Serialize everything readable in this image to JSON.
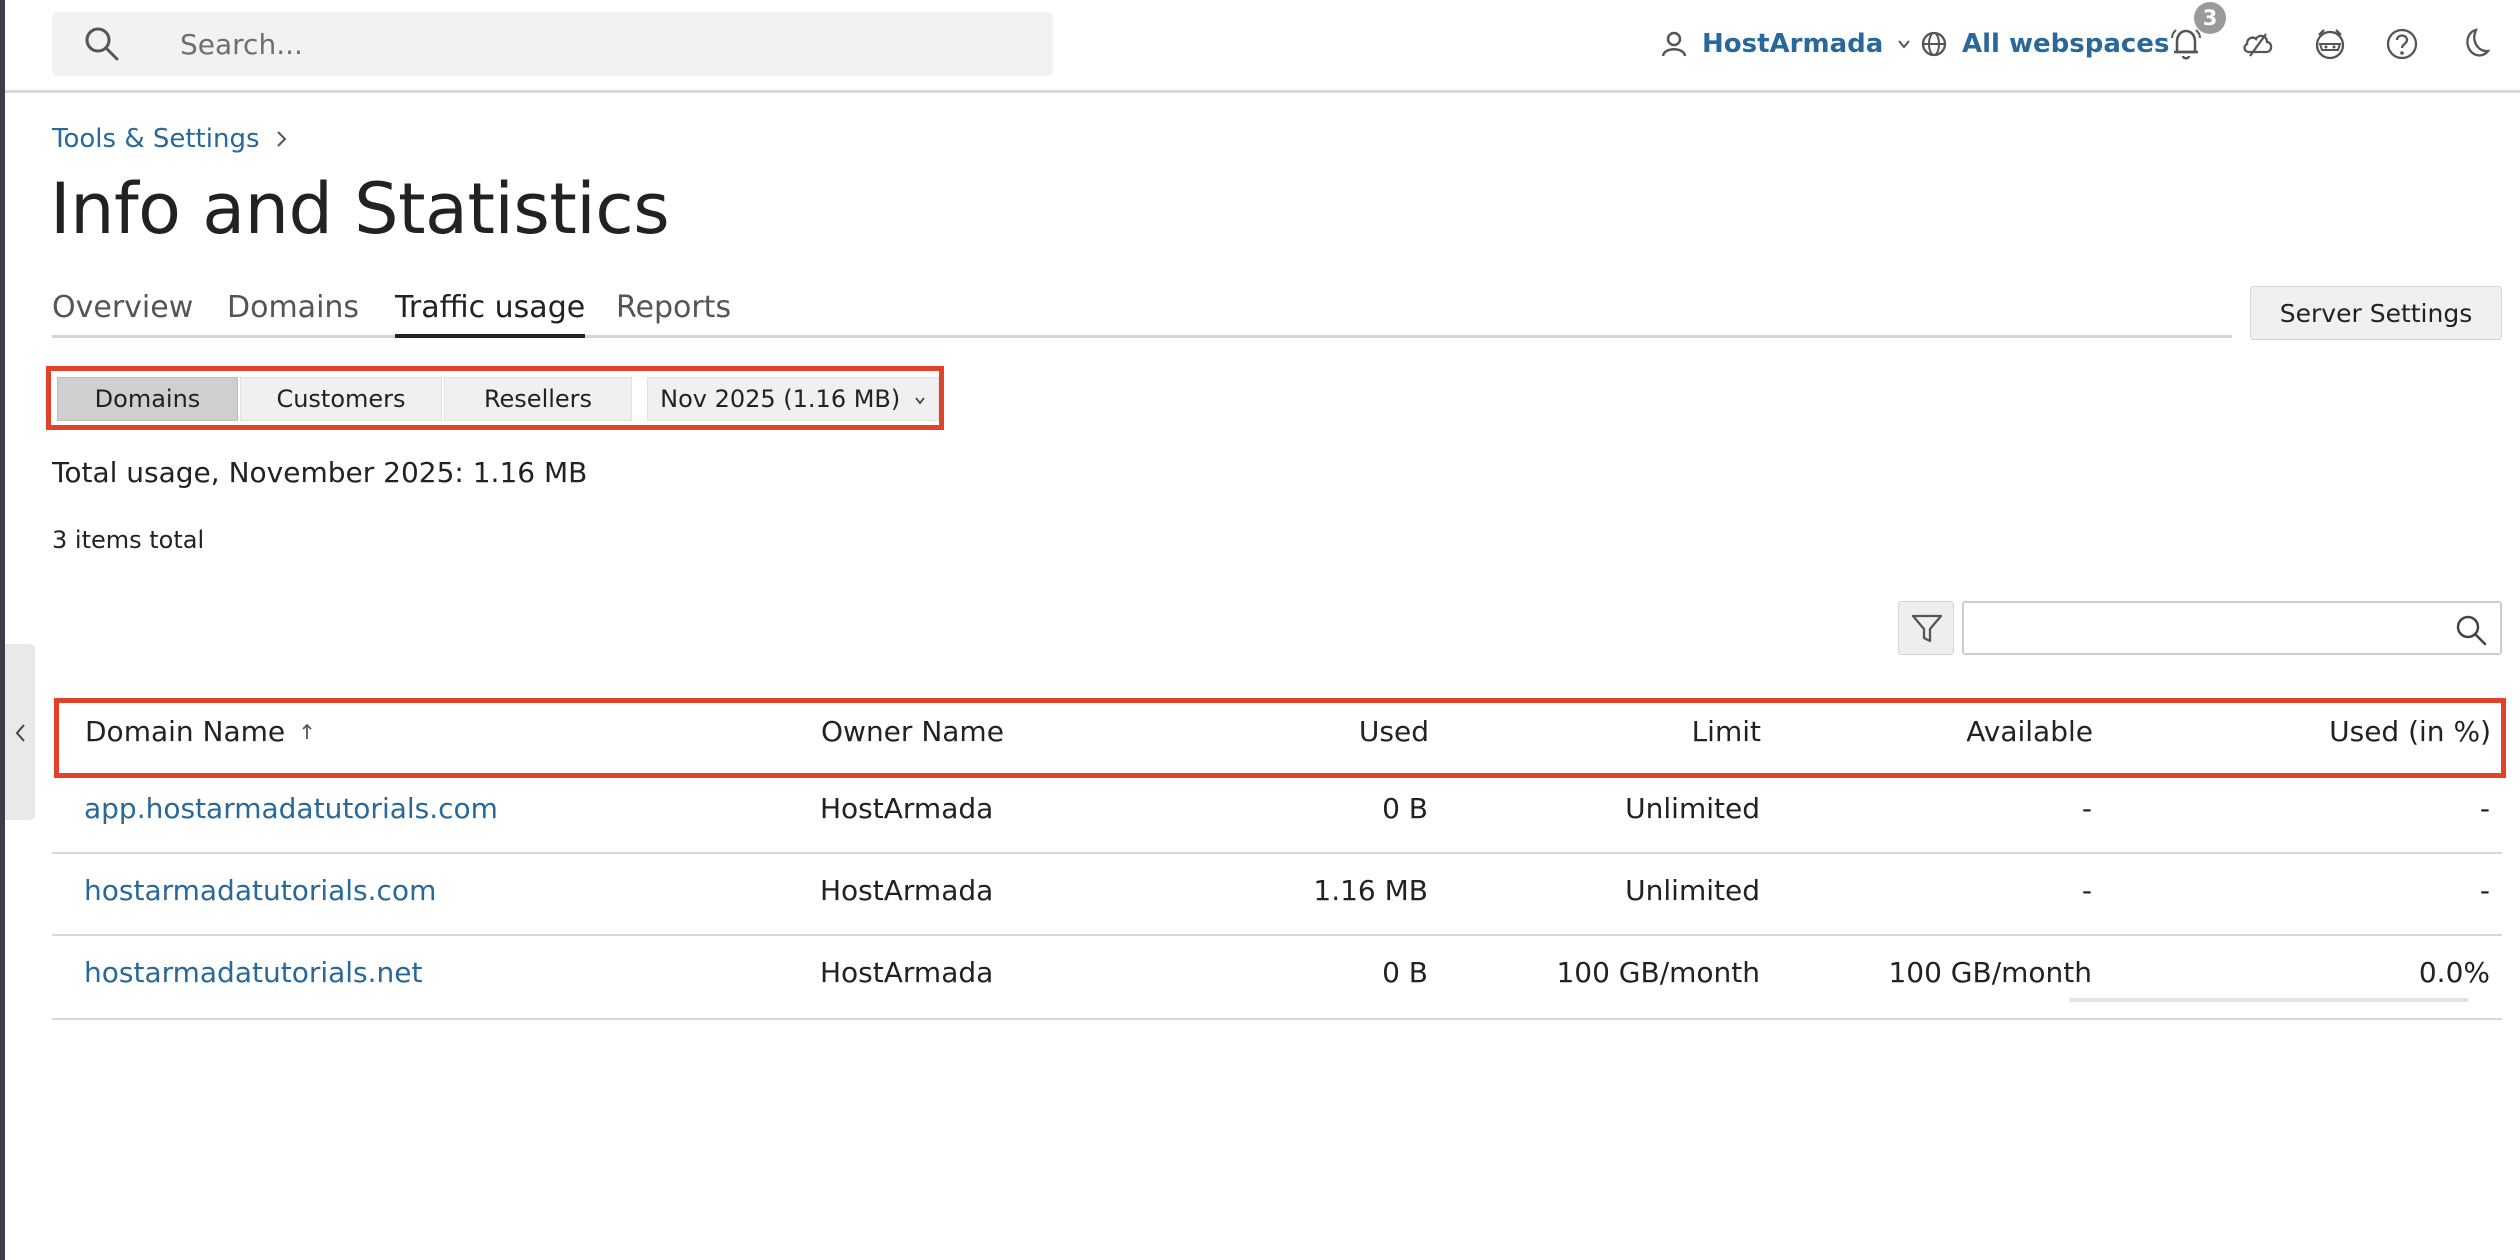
{
  "header": {
    "search_placeholder": "Search...",
    "user_label": "HostArmada",
    "webspaces_label": "All webspaces",
    "notification_count": "3"
  },
  "breadcrumb": {
    "item": "Tools & Settings"
  },
  "page": {
    "title": "Info and Statistics"
  },
  "tabs": [
    {
      "label": "Overview",
      "active": false
    },
    {
      "label": "Domains",
      "active": false
    },
    {
      "label": "Traffic usage",
      "active": true
    },
    {
      "label": "Reports",
      "active": false
    }
  ],
  "server_settings_label": "Server Settings",
  "segments": {
    "domains": "Domains",
    "customers": "Customers",
    "resellers": "Resellers",
    "period": "Nov 2025 (1.16 MB)"
  },
  "summary": {
    "total_usage": "Total usage, November 2025: 1.16 MB",
    "items_total": "3 items total"
  },
  "table": {
    "columns": {
      "domain": "Domain Name",
      "owner": "Owner Name",
      "used": "Used",
      "limit": "Limit",
      "available": "Available",
      "used_pct": "Used (in %)"
    },
    "rows": [
      {
        "domain": "app.hostarmadatutorials.com",
        "owner": "HostArmada",
        "used": "0 B",
        "limit": "Unlimited",
        "available": "-",
        "used_pct": "-"
      },
      {
        "domain": "hostarmadatutorials.com",
        "owner": "HostArmada",
        "used": "1.16 MB",
        "limit": "Unlimited",
        "available": "-",
        "used_pct": "-"
      },
      {
        "domain": "hostarmadatutorials.net",
        "owner": "HostArmada",
        "used": "0 B",
        "limit": "100 GB/month",
        "available": "100 GB/month",
        "used_pct": "0.0%",
        "usage_fraction": 0.0
      }
    ]
  },
  "colors": {
    "link": "#28689b",
    "highlight": "#e2412c"
  }
}
